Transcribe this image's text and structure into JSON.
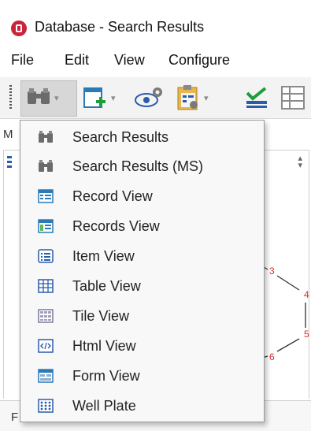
{
  "window": {
    "title": "Database - Search Results"
  },
  "menubar": {
    "items": [
      "File",
      "Edit",
      "View",
      "Configure"
    ]
  },
  "toolbar": {
    "buttons": [
      "binoculars-icon",
      "new-form-icon",
      "view-eye-icon",
      "clipboard-icon",
      "checkmark-icon",
      "grid-icon"
    ]
  },
  "background": {
    "label_m": "M",
    "status_label": "F"
  },
  "molecule": {
    "atom_labels": [
      "3",
      "4",
      "5",
      "6"
    ]
  },
  "dropdown": {
    "items": [
      {
        "label": "Search Results",
        "icon": "binoculars-icon"
      },
      {
        "label": "Search Results (MS)",
        "icon": "binoculars-icon"
      },
      {
        "label": "Record View",
        "icon": "record-view-icon"
      },
      {
        "label": "Records View",
        "icon": "records-view-icon"
      },
      {
        "label": "Item View",
        "icon": "item-view-icon"
      },
      {
        "label": "Table View",
        "icon": "table-view-icon"
      },
      {
        "label": "Tile View",
        "icon": "tile-view-icon"
      },
      {
        "label": "Html View",
        "icon": "html-view-icon"
      },
      {
        "label": "Form View",
        "icon": "form-view-icon"
      },
      {
        "label": "Well Plate",
        "icon": "well-plate-icon"
      }
    ]
  },
  "colors": {
    "accent": "#2a5caa",
    "atom_label": "#d83030",
    "logo": "#c8243a"
  }
}
